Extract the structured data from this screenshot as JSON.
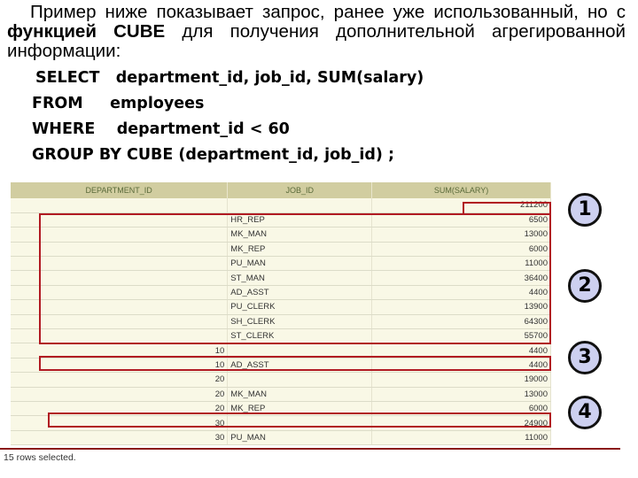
{
  "intro": {
    "part1": "Пример ниже показывает запрос, ранее уже использованный, но с ",
    "bold": "функцией CUBE",
    "part2": " для получения дополнительной агрегированной информации:"
  },
  "code": [
    "SELECT   department_id, job_id, SUM(salary)",
    "FROM     employees",
    "WHERE    department_id < 60",
    "GROUP BY CUBE (department_id, job_id) ;"
  ],
  "table": {
    "headers": [
      "DEPARTMENT_ID",
      "JOB_ID",
      "SUM(SALARY)"
    ],
    "rows": [
      [
        "",
        "",
        "211200"
      ],
      [
        "",
        "HR_REP",
        "6500"
      ],
      [
        "",
        "MK_MAN",
        "13000"
      ],
      [
        "",
        "MK_REP",
        "6000"
      ],
      [
        "",
        "PU_MAN",
        "11000"
      ],
      [
        "",
        "ST_MAN",
        "36400"
      ],
      [
        "",
        "AD_ASST",
        "4400"
      ],
      [
        "",
        "PU_CLERK",
        "13900"
      ],
      [
        "",
        "SH_CLERK",
        "64300"
      ],
      [
        "",
        "ST_CLERK",
        "55700"
      ],
      [
        "10",
        "",
        "4400"
      ],
      [
        "10",
        "AD_ASST",
        "4400"
      ],
      [
        "20",
        "",
        "19000"
      ],
      [
        "20",
        "MK_MAN",
        "13000"
      ],
      [
        "20",
        "MK_REP",
        "6000"
      ],
      [
        "30",
        "",
        "24900"
      ],
      [
        "30",
        "PU_MAN",
        "11000"
      ]
    ]
  },
  "callouts": [
    "1",
    "2",
    "3",
    "4"
  ],
  "footer": "15 rows selected.",
  "colors": {
    "highlight": "#b11a22",
    "header_bg": "#d1cda0",
    "row_bg": "#f9f8e6",
    "callout_bg": "#cdd0f0"
  }
}
